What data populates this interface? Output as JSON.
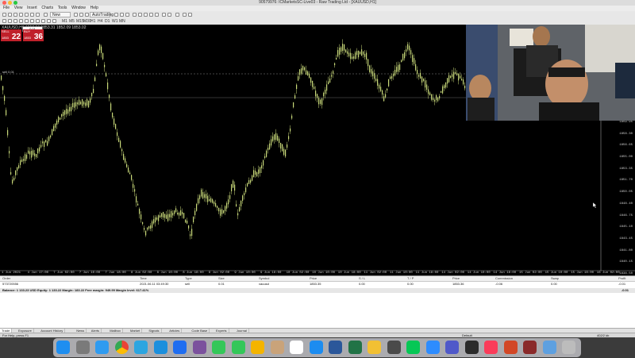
{
  "window": {
    "title": "90579976: ICMarketsSC-Live03 - Raw Trading Ltd - [XAUUSD,H1]",
    "traffic_lights": [
      "#fe5f57",
      "#febc2e",
      "#28c840"
    ]
  },
  "menu": [
    "File",
    "View",
    "Insert",
    "Charts",
    "Tools",
    "Window",
    "Help"
  ],
  "toolbar": {
    "new_order": "New Order",
    "autotrading": "AutoTrading",
    "timeframes": [
      "M1",
      "M5",
      "M15",
      "M30",
      "H1",
      "H4",
      "D1",
      "W1",
      "MN"
    ]
  },
  "chart": {
    "header": "XAUUSD,H1  1852.56 1853.31 1852.09 1853.02",
    "one_click": {
      "sell_label": "SELL",
      "sell_prefix": "1853",
      "sell_big": "22",
      "buy_label": "BUY",
      "buy_prefix": "1853",
      "buy_big": "36",
      "lot": "0.01"
    },
    "line_label": "sell 0.01",
    "price_labels": [
      "1871.50",
      "1869.85",
      "1868.20",
      "1866.55",
      "1864.90",
      "1863.25",
      "1861.60",
      "1859.95",
      "1858.30",
      "1856.65",
      "1855.00",
      "1853.35",
      "1851.70",
      "1850.05",
      "1848.40",
      "1846.75",
      "1845.10",
      "1843.45",
      "1841.80",
      "1840.15",
      "1838.50"
    ],
    "date_labels": [
      "1 Jun 2021",
      "4 Jun 17:00",
      "7 Jun 02:00",
      "7 Jun 10:00",
      "7 Jun 18:00",
      "8 Jun 02:00",
      "8 Jun 10:00",
      "8 Jun 18:00",
      "9 Jun 02:00",
      "9 Jun 10:00",
      "9 Jun 18:00",
      "10 Jun 02:00",
      "10 Jun 10:00",
      "10 Jun 18:00",
      "11 Jun 02:00",
      "11 Jun 10:00",
      "11 Jun 18:00",
      "14 Jun 02:00",
      "14 Jun 10:00",
      "14 Jun 18:00",
      "15 Jun 02:00",
      "15 Jun 10:00",
      "15 Jun 18:00",
      "16 Jun 02:00"
    ]
  },
  "terminal": {
    "columns": [
      "Order",
      "Time",
      "Type",
      "Size",
      "Symbol",
      "Price",
      "S / L",
      "T / P",
      "Price",
      "Commission",
      "Swap",
      "Profit"
    ],
    "row": [
      "573720556",
      "2021.06.11 03:49:30",
      "sell",
      "0.01",
      "xauusd",
      "1853.35",
      "0.00",
      "0.00",
      "1853.36",
      "-0.06",
      "0.00",
      "-0.01"
    ],
    "balance_row": "Balance: 1 133.23 USD  Equity: 1 133.22  Margin: 183.22  Free margin: 949.99  Margin level: 617.41%",
    "balance_profit": "-0.01",
    "tabs": [
      "Trade",
      "Exposure",
      "Account History",
      "News",
      "Alerts",
      "Mailbox",
      "Market",
      "Signals",
      "Articles",
      "Code Base",
      "Experts",
      "Journal"
    ],
    "active_tab": "Trade",
    "status_left": "For Help, press F1",
    "status_right": "Default",
    "status_kb": "402/2 kb"
  },
  "dock": {
    "icons": [
      "finder",
      "launchpad",
      "safari",
      "chrome",
      "telegram",
      "skype",
      "zalo",
      "viber",
      "facetime",
      "messages",
      "photos",
      "contacts",
      "calendar",
      "app-store",
      "word",
      "excel",
      "chrome-canary",
      "quicktime",
      "line",
      "zoom",
      "teams",
      "terminal",
      "music",
      "powerpoint",
      "photo-booth",
      "preview",
      "trash"
    ]
  }
}
